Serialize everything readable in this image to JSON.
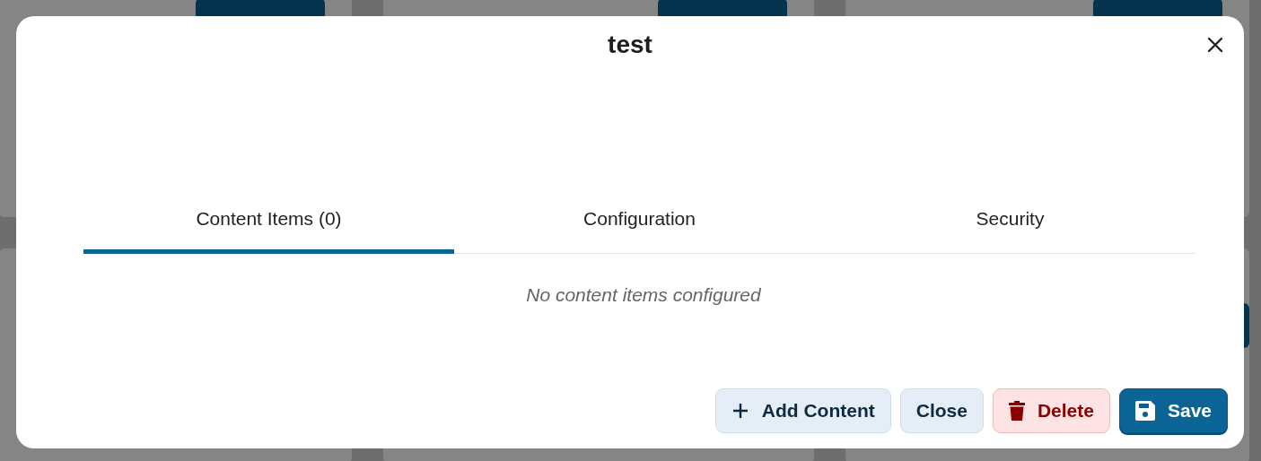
{
  "dialog": {
    "title": "test",
    "tabs": [
      {
        "label": "Content Items (0)",
        "selected": true
      },
      {
        "label": "Configuration",
        "selected": false
      },
      {
        "label": "Security",
        "selected": false
      }
    ],
    "empty_message": "No content items configured",
    "buttons": [
      {
        "label": "Add Content",
        "kind": "add"
      },
      {
        "label": "Close",
        "kind": "secondary"
      },
      {
        "label": "Delete",
        "kind": "danger"
      },
      {
        "label": "Save",
        "kind": "primary"
      }
    ]
  }
}
